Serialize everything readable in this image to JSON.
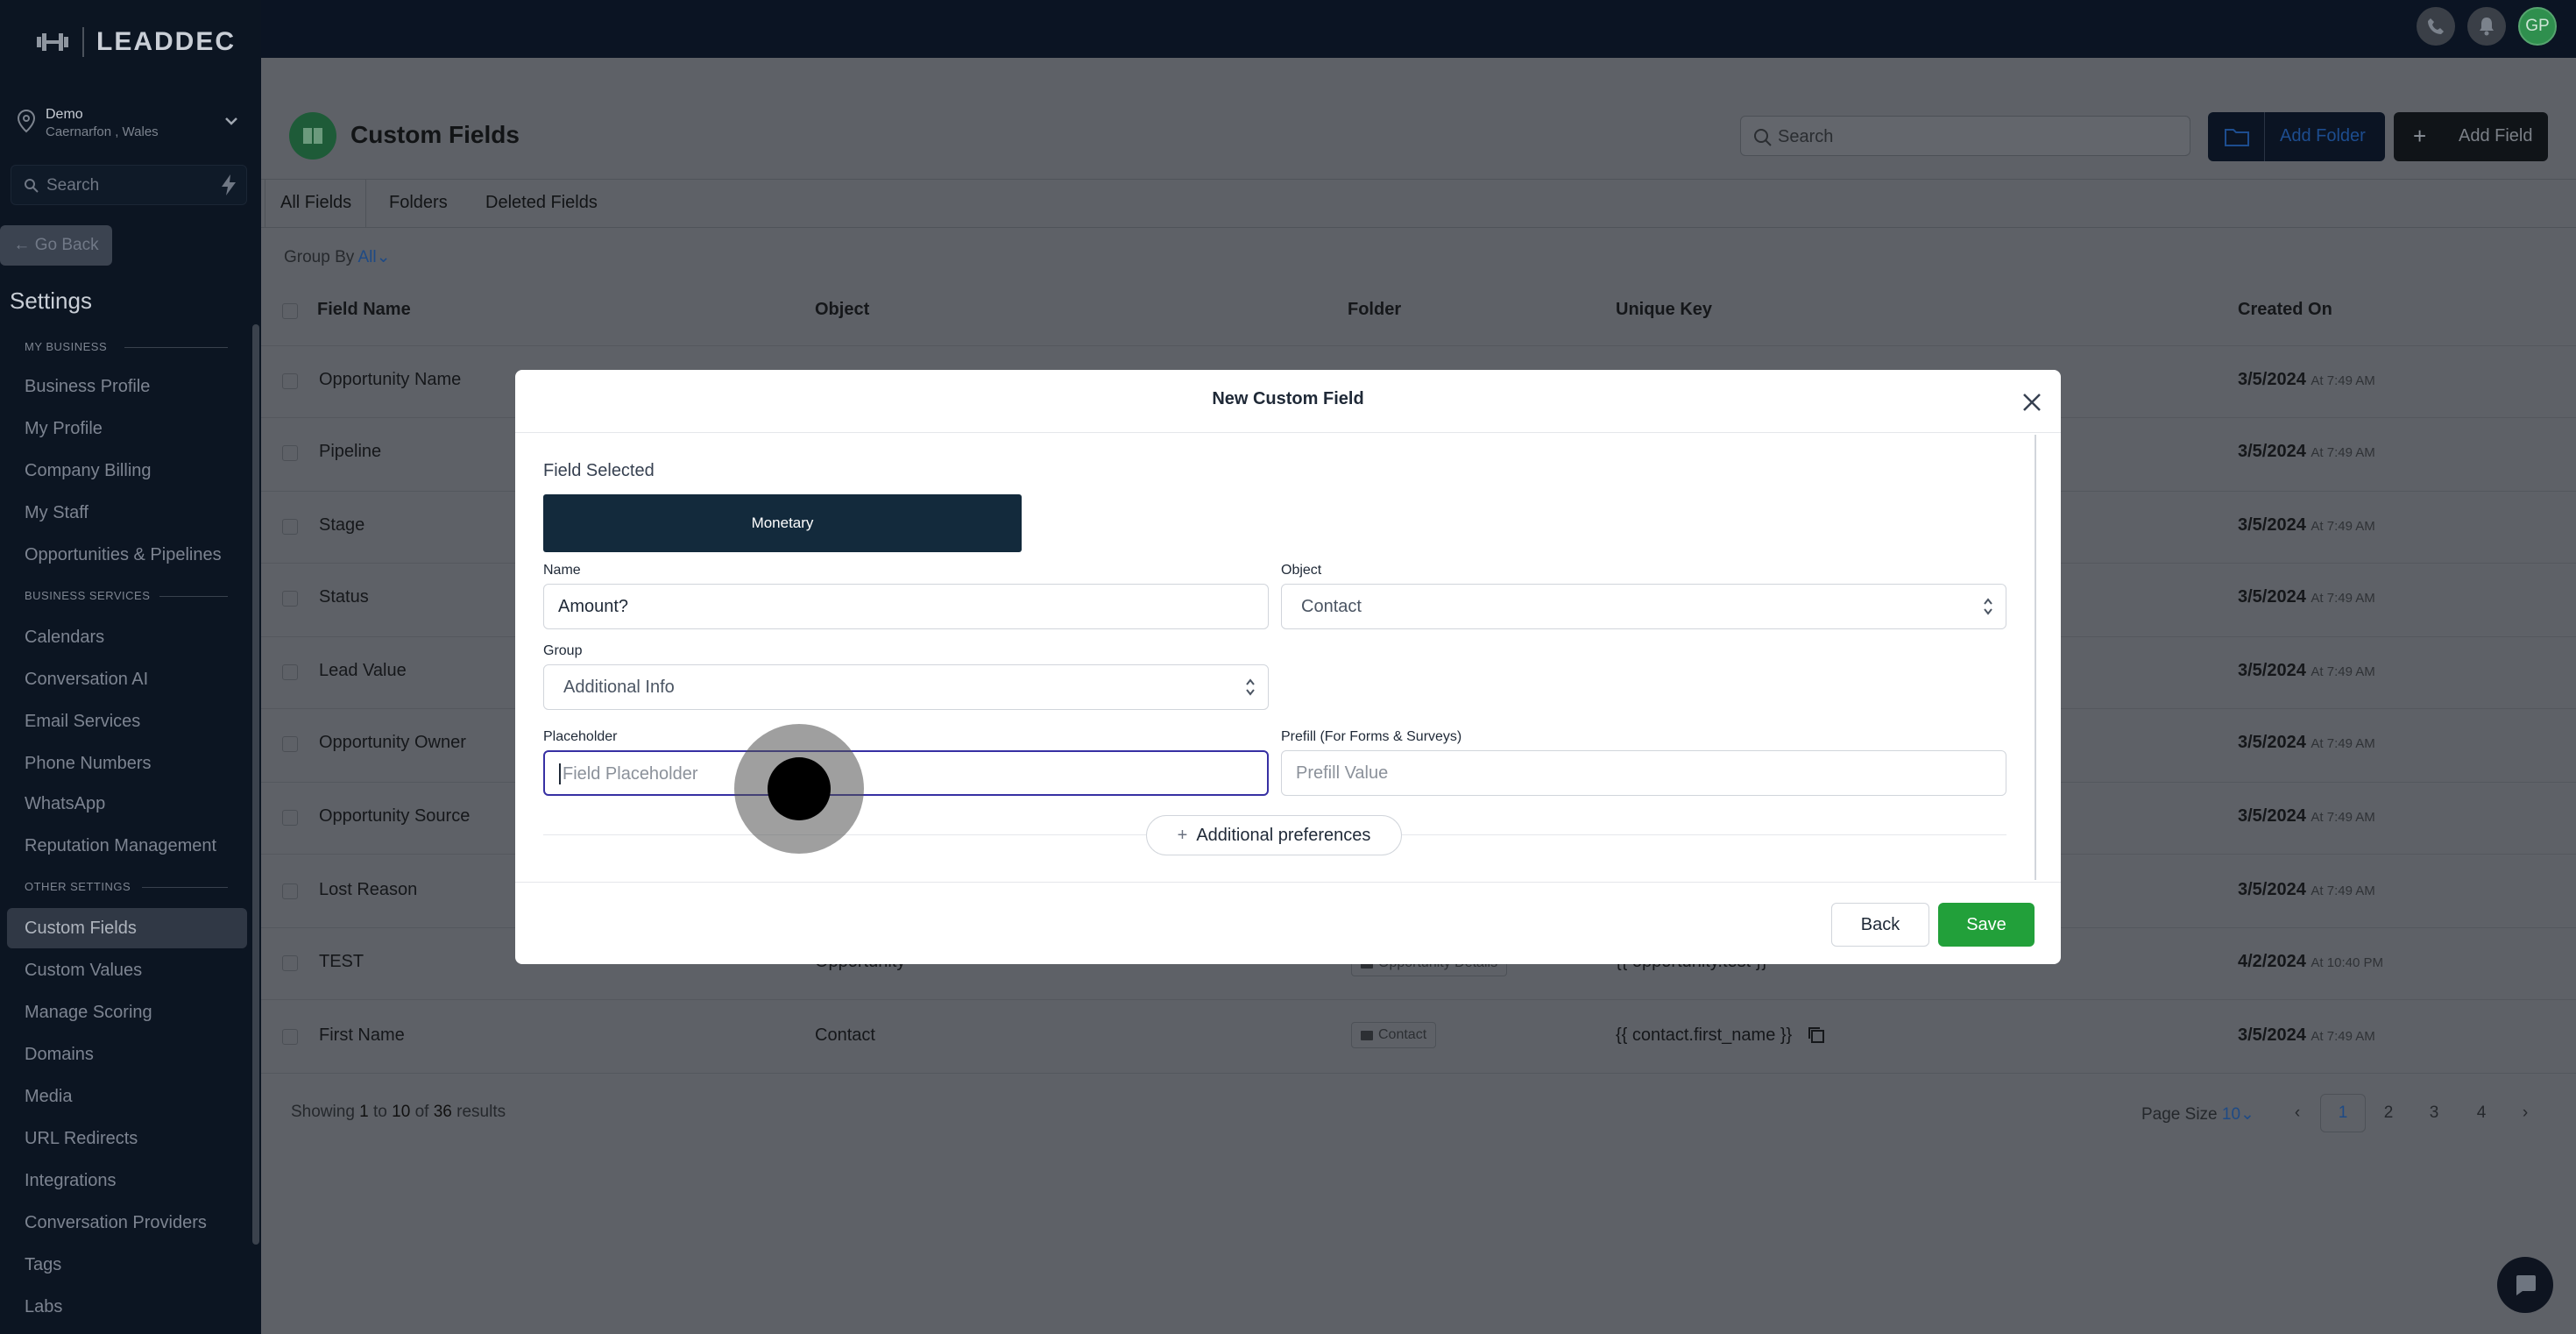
{
  "app": {
    "logo_text": "LEADDEC"
  },
  "topbar": {
    "avatar_initials": "GP"
  },
  "sidebar": {
    "location_name": "Demo",
    "location_sub": "Caernarfon , Wales",
    "search_placeholder": "Search",
    "go_back": "Go Back",
    "settings_title": "Settings",
    "sections": {
      "my_business": "MY BUSINESS",
      "business_services": "BUSINESS SERVICES",
      "other_settings": "OTHER SETTINGS"
    },
    "items": {
      "business_profile": "Business Profile",
      "my_profile": "My Profile",
      "company_billing": "Company Billing",
      "my_staff": "My Staff",
      "opportunities": "Opportunities & Pipelines",
      "calendars": "Calendars",
      "conversation_ai": "Conversation AI",
      "email_services": "Email Services",
      "phone_numbers": "Phone Numbers",
      "whatsapp": "WhatsApp",
      "reputation": "Reputation Management",
      "custom_fields": "Custom Fields",
      "custom_values": "Custom Values",
      "manage_scoring": "Manage Scoring",
      "domains": "Domains",
      "media": "Media",
      "url_redirects": "URL Redirects",
      "integrations": "Integrations",
      "conversation_providers": "Conversation Providers",
      "tags": "Tags",
      "labs": "Labs"
    }
  },
  "header": {
    "title": "Custom Fields",
    "search_placeholder": "Search",
    "add_folder": "Add Folder",
    "add_field": "Add Field"
  },
  "tabs": {
    "all_fields": "All Fields",
    "folders": "Folders",
    "deleted_fields": "Deleted Fields"
  },
  "group_by": {
    "label": "Group By",
    "value": "All"
  },
  "table": {
    "columns": {
      "field_name": "Field Name",
      "object": "Object",
      "folder": "Folder",
      "unique_key": "Unique Key",
      "created_on": "Created On"
    },
    "rows": [
      {
        "name": "Opportunity Name",
        "object": "",
        "folder": "",
        "key": "",
        "date": "3/5/2024",
        "time": "At 7:49 AM"
      },
      {
        "name": "Pipeline",
        "object": "",
        "folder": "",
        "key": "",
        "date": "3/5/2024",
        "time": "At 7:49 AM"
      },
      {
        "name": "Stage",
        "object": "",
        "folder": "",
        "key": "",
        "date": "3/5/2024",
        "time": "At 7:49 AM"
      },
      {
        "name": "Status",
        "object": "",
        "folder": "",
        "key": "",
        "date": "3/5/2024",
        "time": "At 7:49 AM"
      },
      {
        "name": "Lead Value",
        "object": "",
        "folder": "",
        "key": "",
        "date": "3/5/2024",
        "time": "At 7:49 AM"
      },
      {
        "name": "Opportunity Owner",
        "object": "",
        "folder": "",
        "key": "",
        "date": "3/5/2024",
        "time": "At 7:49 AM"
      },
      {
        "name": "Opportunity Source",
        "object": "",
        "folder": "",
        "key": "",
        "date": "3/5/2024",
        "time": "At 7:49 AM"
      },
      {
        "name": "Lost Reason",
        "object": "",
        "folder": "",
        "key": "",
        "date": "3/5/2024",
        "time": "At 7:49 AM"
      },
      {
        "name": "TEST",
        "object": "Opportunity",
        "folder": "Opportunity Details",
        "key": "{{ opportunity.test }}",
        "date": "4/2/2024",
        "time": "At 10:40 PM"
      },
      {
        "name": "First Name",
        "object": "Contact",
        "folder": "Contact",
        "key": "{{ contact.first_name }}",
        "date": "3/5/2024",
        "time": "At 7:49 AM"
      }
    ]
  },
  "pagination": {
    "showing_prefix": "Showing",
    "from": "1",
    "to_word": "to",
    "to": "10",
    "of_word": "of",
    "total": "36",
    "results_word": "results",
    "page_size_label": "Page Size",
    "page_size": "10",
    "pages": [
      "1",
      "2",
      "3",
      "4"
    ]
  },
  "modal": {
    "title": "New Custom Field",
    "field_selected_label": "Field Selected",
    "field_type": "Monetary",
    "name_label": "Name",
    "name_value": "Amount?",
    "object_label": "Object",
    "object_value": "Contact",
    "group_label": "Group",
    "group_value": "Additional Info",
    "placeholder_label": "Placeholder",
    "placeholder_placeholder": "Field Placeholder",
    "prefill_label": "Prefill (For Forms & Surveys)",
    "prefill_placeholder": "Prefill Value",
    "additional_preferences": "Additional preferences",
    "back": "Back",
    "save": "Save"
  },
  "colors": {
    "save_green": "#22a03a",
    "monetary_bg": "#132a3c",
    "sidebar_bg": "#0c1522",
    "link_blue": "#1e4a85"
  }
}
